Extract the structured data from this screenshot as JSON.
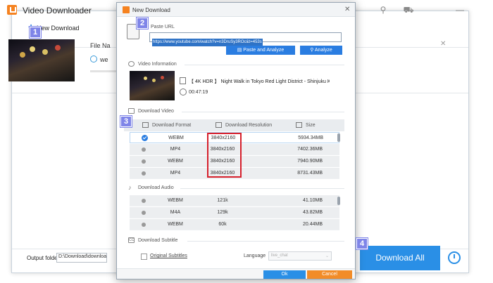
{
  "app": {
    "title": "Video Downloader",
    "toolbar": {
      "new_download_label": "New Download",
      "new_download_plus": "+"
    },
    "task": {
      "file_label": "File Na",
      "format_short": "we"
    },
    "bottom": {
      "output_folder_label": "Output folder:",
      "output_folder_value": "D:\\Download\\download v",
      "download_all_label": "Download All"
    }
  },
  "badges": {
    "b1": "1",
    "b2": "2",
    "b3": "3",
    "b4": "4"
  },
  "dialog": {
    "title": "New Download",
    "paste_url_label": "Paste URL",
    "url_value": "https://www.youtube.com/watch?v=n3DruSy3ROc&t=453s",
    "paste_and_analyze_label": "Paste and Analyze",
    "analyze_label": "Analyze",
    "video_info_label": "Video Information",
    "video_title": "【 4K HDR 】 Night Walk in Tokyo Red Light District - Shinjuku K...",
    "video_duration": "00:47:19",
    "download_video_label": "Download Video",
    "columns": {
      "format": "Download Format",
      "resolution": "Download Resolution",
      "size": "Size"
    },
    "video_rows": [
      {
        "format": "WEBM",
        "resolution": "3840x2160",
        "size": "5934.34MB",
        "selected": true
      },
      {
        "format": "MP4",
        "resolution": "3840x2160",
        "size": "7402.36MB",
        "selected": false
      },
      {
        "format": "WEBM",
        "resolution": "3840x2160",
        "size": "7940.90MB",
        "selected": false
      },
      {
        "format": "MP4",
        "resolution": "3840x2160",
        "size": "8731.43MB",
        "selected": false
      }
    ],
    "download_audio_label": "Download Audio",
    "audio_rows": [
      {
        "format": "WEBM",
        "bitrate": "121k",
        "size": "41.10MB"
      },
      {
        "format": "M4A",
        "bitrate": "129k",
        "size": "43.82MB"
      },
      {
        "format": "WEBM",
        "bitrate": "60k",
        "size": "20.44MB"
      }
    ],
    "download_subtitle_label": "Download Subtitle",
    "original_subtitles_label": "Original Subtitles",
    "language_label": "Language",
    "language_value": "live_chat",
    "ok_label": "Ok",
    "cancel_label": "Cancel",
    "close_glyph": "✕"
  },
  "colors": {
    "accent_blue": "#2a7de1",
    "cancel_orange": "#f28c28",
    "highlight_red": "#d6202c",
    "badge_purple": "#7f85e8"
  }
}
